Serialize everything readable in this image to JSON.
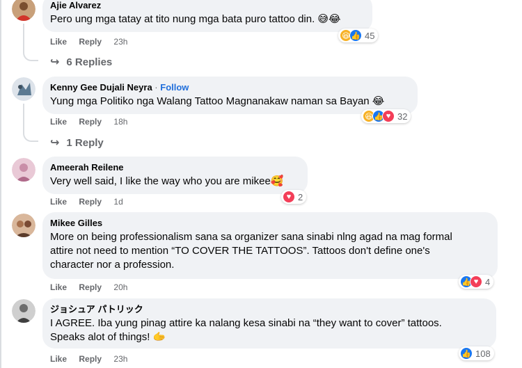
{
  "comments": [
    {
      "author": "Ajie Alvarez",
      "follow": "",
      "text": "Pero ung mga tatay at tito nung mga bata puro tattoo din. 😅😂",
      "like_label": "Like",
      "reply_label": "Reply",
      "time": "23h",
      "reaction_count": "45",
      "replies_label": "6 Replies",
      "avatar_color": "#c8a07a"
    },
    {
      "author": "Kenny Gee Dujali Neyra",
      "follow": "Follow",
      "text": "Yung mga Politiko nga Walang Tattoo Magnanakaw naman sa Bayan 😂",
      "like_label": "Like",
      "reply_label": "Reply",
      "time": "18h",
      "reaction_count": "32",
      "replies_label": "1 Reply",
      "avatar_color": "#5c7a92"
    },
    {
      "author": "Ameerah Reilene",
      "follow": "",
      "text": "Very well said, I like the way who you are mikee🥰",
      "like_label": "Like",
      "reply_label": "Reply",
      "time": "1d",
      "reaction_count": "2",
      "avatar_color": "#c98ea8"
    },
    {
      "author": "Mikee Gilles",
      "follow": "",
      "text_lines": [
        "More on being professionalism sana sa organizer sana sinabi nlng agad na mag formal",
        "attire not need to mention “TO COVER THE TATTOOS”. Tattoos don't define one's",
        "character nor a profession."
      ],
      "like_label": "Like",
      "reply_label": "Reply",
      "time": "20h",
      "reaction_count": "4",
      "avatar_color": "#a8724f"
    },
    {
      "author": "ジョシュア パトリック",
      "follow": "",
      "text_lines": [
        "I AGREE. Iba yung pinag attire ka nalang kesa sinabi na “they want to cover” tattoos.",
        "Speaks alot of things! 🫱"
      ],
      "like_label": "Like",
      "reply_label": "Reply",
      "time": "23h",
      "reaction_count": "108",
      "avatar_color": "#6d6d6d"
    }
  ],
  "colors": {
    "bubble": "#f0f2f5",
    "follow": "#216fdb",
    "muted": "#65676b",
    "like_blue": "#1877f2",
    "love_red": "#f33e58",
    "haha_yellow": "#f7b125"
  }
}
